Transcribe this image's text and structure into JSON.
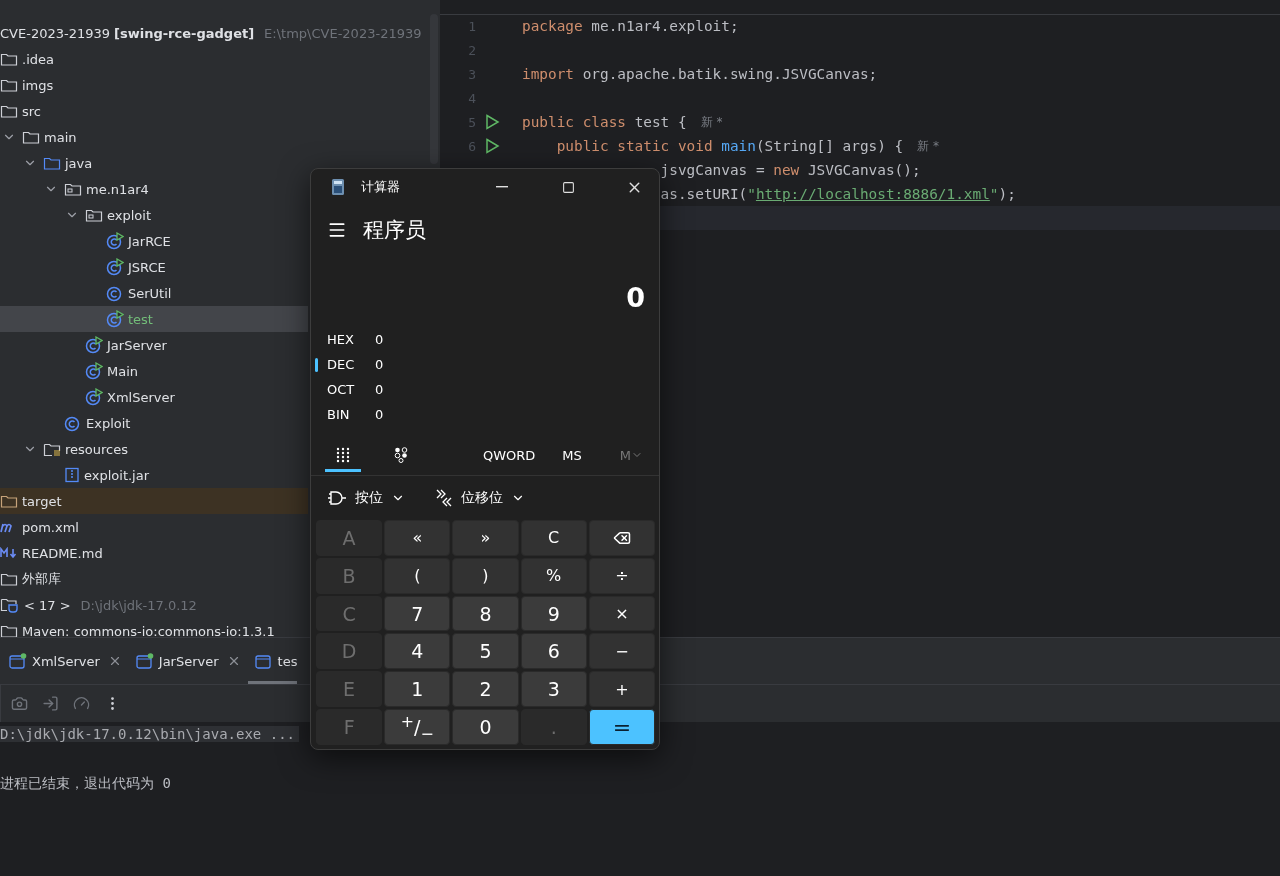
{
  "project_tree": {
    "items": [
      {
        "kind": "project-root",
        "name": "CVE-2023-21939",
        "module": "[swing-rce-gadget]",
        "path": "E:\\tmp\\CVE-2023-21939",
        "selected": false,
        "children": [
          {
            "kind": "folder",
            "name": ".idea",
            "selected": false
          },
          {
            "kind": "folder",
            "name": "imgs",
            "selected": false
          },
          {
            "kind": "folder",
            "name": "src",
            "selected": false,
            "children": [
              {
                "kind": "folder",
                "name": "main",
                "expanded": true,
                "selected": false,
                "children": [
                  {
                    "kind": "source-folder",
                    "name": "java",
                    "expanded": true,
                    "selected": false,
                    "children": [
                      {
                        "kind": "package",
                        "name": "me.n1ar4",
                        "expanded": true,
                        "selected": false,
                        "children": [
                          {
                            "kind": "package",
                            "name": "exploit",
                            "expanded": true,
                            "selected": false,
                            "children": [
                              {
                                "kind": "runnable-class",
                                "name": "JarRCE",
                                "selected": false
                              },
                              {
                                "kind": "runnable-class",
                                "name": "JSRCE",
                                "selected": false
                              },
                              {
                                "kind": "class",
                                "name": "SerUtil",
                                "selected": false
                              },
                              {
                                "kind": "runnable-class",
                                "name": "test",
                                "selected": true,
                                "added": true
                              }
                            ]
                          },
                          {
                            "kind": "runnable-class",
                            "name": "JarServer",
                            "selected": false
                          },
                          {
                            "kind": "runnable-class",
                            "name": "Main",
                            "selected": false
                          },
                          {
                            "kind": "runnable-class",
                            "name": "XmlServer",
                            "selected": false
                          }
                        ]
                      },
                      {
                        "kind": "class",
                        "name": "Exploit",
                        "selected": false
                      }
                    ]
                  },
                  {
                    "kind": "resources-folder",
                    "name": "resources",
                    "expanded": true,
                    "selected": false,
                    "children": [
                      {
                        "kind": "jar",
                        "name": "exploit.jar",
                        "selected": false
                      }
                    ]
                  }
                ]
              }
            ]
          },
          {
            "kind": "excluded-folder",
            "name": "target",
            "selected": false
          },
          {
            "kind": "maven",
            "name": "pom.xml",
            "selected": false
          },
          {
            "kind": "markdown",
            "name": "README.md",
            "selected": false
          }
        ]
      },
      {
        "kind": "library-group",
        "name": "外部库",
        "selected": false,
        "children": [
          {
            "kind": "jdk",
            "name": "< 17 >",
            "path": "D:\\jdk\\jdk-17.0.12",
            "selected": false
          },
          {
            "kind": "library",
            "name": "Maven: commons-io:commons-io:1.3.1",
            "selected": false
          }
        ]
      }
    ]
  },
  "editor": {
    "lines": [
      {
        "kind": "top-level",
        "number": "1",
        "tokens": [
          {
            "kind": "keyword",
            "text": "package"
          },
          {
            "kind": "plain",
            "text": " me.n1ar4.exploit;"
          }
        ]
      },
      {
        "kind": "top-level",
        "number": "2"
      },
      {
        "kind": "top-level",
        "number": "3",
        "tokens": [
          {
            "kind": "keyword",
            "text": "import"
          },
          {
            "kind": "plain",
            "text": " org.apache.batik.swing.JSVGCanvas;"
          }
        ]
      },
      {
        "kind": "top-level",
        "number": "4"
      },
      {
        "kind": "top-level",
        "number": "5",
        "runnable": true,
        "tokens": [
          {
            "kind": "keyword",
            "text": "public class"
          },
          {
            "kind": "plain",
            "text": " test {"
          },
          {
            "kind": "hint",
            "text": "新 *"
          }
        ]
      },
      {
        "kind": "nested",
        "number": "6",
        "runnable": true,
        "tokens": [
          {
            "kind": "keyword",
            "text": "public static void"
          },
          {
            "kind": "function",
            "text": " main"
          },
          {
            "kind": "plain",
            "text": "(String[] args) {"
          },
          {
            "kind": "hint",
            "text": "新 *"
          }
        ]
      },
      {
        "kind": "covered",
        "tokens": [
          {
            "kind": "plain",
            "text": "jsvgCanvas = "
          },
          {
            "kind": "keyword",
            "text": "new"
          },
          {
            "kind": "plain",
            "text": " JSVGCanvas();"
          }
        ]
      },
      {
        "kind": "covered",
        "tokens": [
          {
            "kind": "plain",
            "text": "as.setURI("
          },
          {
            "kind": "string",
            "text": "\""
          },
          {
            "kind": "url",
            "text": "http://localhost:8886/1.xml"
          },
          {
            "kind": "string",
            "text": "\""
          },
          {
            "kind": "plain",
            "text": ");"
          }
        ]
      },
      {
        "kind": "caret-line"
      }
    ]
  },
  "run_panel": {
    "tabs": [
      {
        "label": "XmlServer",
        "running": true,
        "closable": true,
        "selected": false
      },
      {
        "label": "JarServer",
        "running": true,
        "closable": true,
        "selected": false
      },
      {
        "label": "tes",
        "running": false,
        "selected": true
      }
    ],
    "console": [
      {
        "kind": "command",
        "text": "D:\\jdk\\jdk-17.0.12\\bin\\java.exe ..."
      },
      {
        "kind": "output",
        "text": "进程已结束，退出代码为 0"
      }
    ]
  },
  "calculator": {
    "title": "计算器",
    "mode": "程序员",
    "display": "0",
    "radix": [
      {
        "name": "HEX",
        "value": "0",
        "selected": false
      },
      {
        "name": "DEC",
        "value": "0",
        "selected": true
      },
      {
        "name": "OCT",
        "value": "0",
        "selected": false
      },
      {
        "name": "BIN",
        "value": "0",
        "selected": false
      }
    ],
    "views": [
      {
        "kind": "keypad",
        "selected": true
      },
      {
        "kind": "bit-toggle",
        "selected": false
      }
    ],
    "word_size": "QWORD",
    "memory": [
      {
        "label": "MS",
        "disabled": false,
        "dropdown": false
      },
      {
        "label": "M",
        "disabled": true,
        "dropdown": true
      }
    ],
    "menus": [
      {
        "kind": "bitwise",
        "label": "按位"
      },
      {
        "kind": "bitshift",
        "label": "位移位"
      }
    ],
    "keys": [
      {
        "kind": "digit",
        "label": "A",
        "disabled": true
      },
      {
        "kind": "operator",
        "label": "«",
        "disabled": false
      },
      {
        "kind": "operator",
        "label": "»",
        "disabled": false
      },
      {
        "kind": "operator",
        "label": "C",
        "disabled": false
      },
      {
        "kind": "backspace",
        "disabled": false
      },
      {
        "kind": "digit",
        "label": "B",
        "disabled": true
      },
      {
        "kind": "operator",
        "label": "(",
        "disabled": false
      },
      {
        "kind": "operator",
        "label": ")",
        "disabled": false
      },
      {
        "kind": "operator",
        "label": "%",
        "disabled": false
      },
      {
        "kind": "operator",
        "label": "÷",
        "disabled": false
      },
      {
        "kind": "digit",
        "label": "C",
        "disabled": true
      },
      {
        "kind": "digit",
        "label": "7",
        "disabled": false
      },
      {
        "kind": "digit",
        "label": "8",
        "disabled": false
      },
      {
        "kind": "digit",
        "label": "9",
        "disabled": false
      },
      {
        "kind": "operator",
        "label": "×",
        "disabled": false
      },
      {
        "kind": "digit",
        "label": "D",
        "disabled": true
      },
      {
        "kind": "digit",
        "label": "4",
        "disabled": false
      },
      {
        "kind": "digit",
        "label": "5",
        "disabled": false
      },
      {
        "kind": "digit",
        "label": "6",
        "disabled": false
      },
      {
        "kind": "operator",
        "label": "−",
        "disabled": false
      },
      {
        "kind": "digit",
        "label": "E",
        "disabled": true
      },
      {
        "kind": "digit",
        "label": "1",
        "disabled": false
      },
      {
        "kind": "digit",
        "label": "2",
        "disabled": false
      },
      {
        "kind": "digit",
        "label": "3",
        "disabled": false
      },
      {
        "kind": "operator",
        "label": "+",
        "disabled": false
      },
      {
        "kind": "digit",
        "label": "F",
        "disabled": true
      },
      {
        "kind": "digit",
        "label": "$^{+}$/$_{−}$",
        "disabled": false
      },
      {
        "kind": "digit",
        "label": "0",
        "disabled": false
      },
      {
        "kind": "digit",
        "label": ".",
        "disabled": true
      },
      {
        "kind": "equals",
        "label": "=",
        "disabled": false
      }
    ]
  }
}
